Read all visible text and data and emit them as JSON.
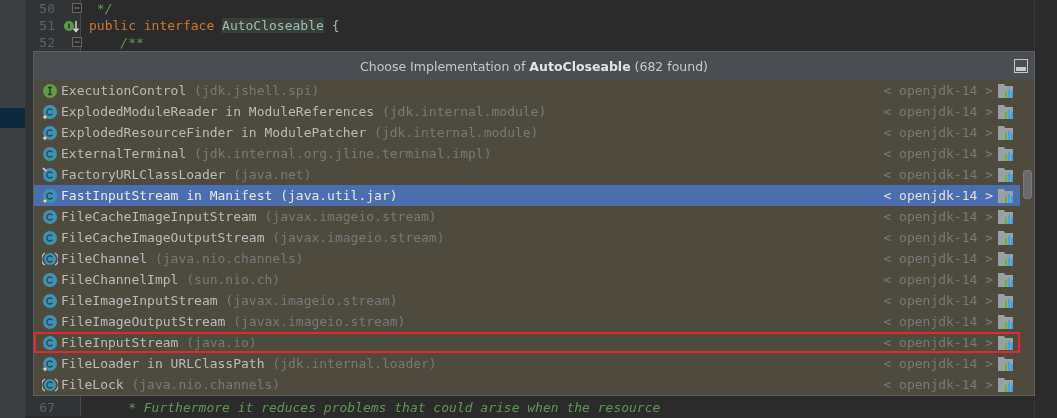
{
  "editor": {
    "lines_above": [
      {
        "number": "50",
        "foldable": true,
        "implemented": false,
        "tokens": [
          {
            "text": " */",
            "kind": "doc"
          }
        ]
      },
      {
        "number": "51",
        "foldable": false,
        "implemented": true,
        "tokens": [
          {
            "text": "public interface ",
            "kind": "keyword"
          },
          {
            "text": "AutoCloseable",
            "kind": "match"
          },
          {
            "text": " {",
            "kind": "plain"
          }
        ]
      },
      {
        "number": "52",
        "foldable": true,
        "implemented": false,
        "tokens": [
          {
            "text": "    /**",
            "kind": "doc"
          }
        ]
      }
    ],
    "lines_below": [
      {
        "number": "67",
        "foldable": false,
        "implemented": false,
        "tokens": [
          {
            "text": "     * Furthermore it reduces problems that could arise when the resource",
            "kind": "doc"
          }
        ]
      }
    ]
  },
  "popup": {
    "title": "Choose Implementation of **AutoCloseable** (682 found)",
    "rows": [
      {
        "kind": "interface",
        "name": "ExecutionControl",
        "package": "(jdk.jshell.spi)",
        "location": "< openjdk-14 >",
        "selected": false,
        "highlighted": false
      },
      {
        "kind": "inner-class",
        "name": "ExplodedModuleReader in ModuleReferences",
        "package": "(jdk.internal.module)",
        "location": "< openjdk-14 >",
        "selected": false,
        "highlighted": false
      },
      {
        "kind": "inner-class",
        "name": "ExplodedResourceFinder in ModulePatcher",
        "package": "(jdk.internal.module)",
        "location": "< openjdk-14 >",
        "selected": false,
        "highlighted": false
      },
      {
        "kind": "class",
        "name": "ExternalTerminal",
        "package": "(jdk.internal.org.jline.terminal.impl)",
        "location": "< openjdk-14 >",
        "selected": false,
        "highlighted": false
      },
      {
        "kind": "marked-class",
        "name": "FactoryURLClassLoader",
        "package": "(java.net)",
        "location": "< openjdk-14 >",
        "selected": false,
        "highlighted": false
      },
      {
        "kind": "inner-class",
        "name": "FastInputStream in Manifest",
        "package": "(java.util.jar)",
        "location": "< openjdk-14 >",
        "selected": true,
        "highlighted": false
      },
      {
        "kind": "class",
        "name": "FileCacheImageInputStream",
        "package": "(javax.imageio.stream)",
        "location": "< openjdk-14 >",
        "selected": false,
        "highlighted": false
      },
      {
        "kind": "class",
        "name": "FileCacheImageOutputStream",
        "package": "(javax.imageio.stream)",
        "location": "< openjdk-14 >",
        "selected": false,
        "highlighted": false
      },
      {
        "kind": "abstract-class",
        "name": "FileChannel",
        "package": "(java.nio.channels)",
        "location": "< openjdk-14 >",
        "selected": false,
        "highlighted": false
      },
      {
        "kind": "class",
        "name": "FileChannelImpl",
        "package": "(sun.nio.ch)",
        "location": "< openjdk-14 >",
        "selected": false,
        "highlighted": false
      },
      {
        "kind": "class",
        "name": "FileImageInputStream",
        "package": "(javax.imageio.stream)",
        "location": "< openjdk-14 >",
        "selected": false,
        "highlighted": false
      },
      {
        "kind": "class",
        "name": "FileImageOutputStream",
        "package": "(javax.imageio.stream)",
        "location": "< openjdk-14 >",
        "selected": false,
        "highlighted": false
      },
      {
        "kind": "class",
        "name": "FileInputStream",
        "package": "(java.io)",
        "location": "< openjdk-14 >",
        "selected": false,
        "highlighted": true
      },
      {
        "kind": "inner-class",
        "name": "FileLoader in URLClassPath",
        "package": "(jdk.internal.loader)",
        "location": "< openjdk-14 >",
        "selected": false,
        "highlighted": false
      },
      {
        "kind": "abstract-class",
        "name": "FileLock",
        "package": "(java.nio.channels)",
        "location": "< openjdk-14 >",
        "selected": false,
        "highlighted": false
      }
    ]
  }
}
